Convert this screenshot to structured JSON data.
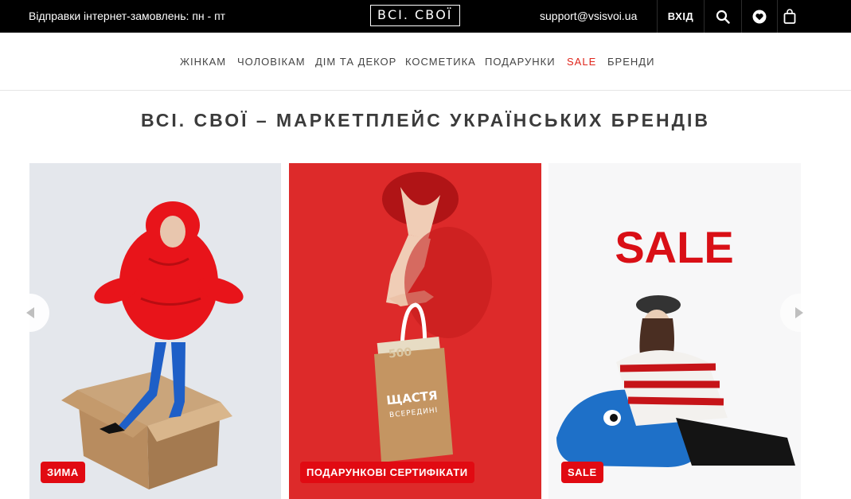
{
  "topbar": {
    "shipping_text": "Відправки інтернет-замовлень: пн - пт",
    "logo_text": "ВСІ. СВОЇ",
    "email": "support@vsisvoi.ua",
    "login_label": "ВХІД",
    "icons": [
      "search-icon",
      "heart-icon",
      "cart-icon"
    ]
  },
  "nav": {
    "items": [
      "ЖІНКАМ",
      "ЧОЛОВІКАМ",
      "ДІМ ТА ДЕКОР",
      "КОСМЕТИКА",
      "ПОДАРУНКИ",
      "SALE",
      "БРЕНДИ"
    ],
    "sale_color": "#e0261c"
  },
  "headline": "ВСІ. СВОЇ – МАРКЕТПЛЕЙС УКРАЇНСЬКИХ БРЕНДІВ",
  "banners": [
    {
      "badge": "ЗИМА"
    },
    {
      "badge": "ПОДАРУНКОВІ СЕРТИФІКАТИ",
      "bag_title": "ЩАСТЯ",
      "bag_subtitle": "ВСЕРЕДИНІ",
      "bag_amount": "500"
    },
    {
      "badge": "SALE",
      "big_text": "SALE"
    }
  ],
  "colors": {
    "accent": "#e10a12",
    "topbar": "#000000"
  }
}
